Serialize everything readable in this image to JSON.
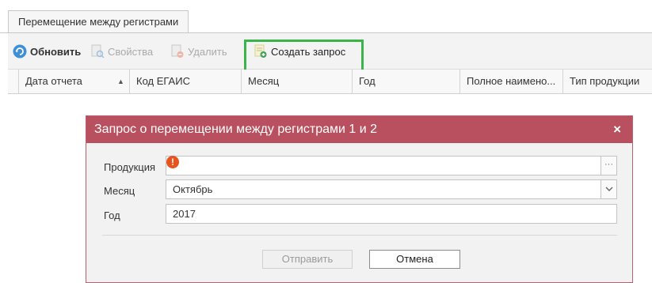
{
  "tab": {
    "label": "Перемещение между регистрами"
  },
  "toolbar": {
    "refresh": "Обновить",
    "properties": "Свойства",
    "delete": "Удалить",
    "create_request": "Создать запрос"
  },
  "grid": {
    "columns": [
      "Дата отчета",
      "Код ЕГАИС",
      "Месяц",
      "Год",
      "Полное наимено...",
      "Тип продукции"
    ]
  },
  "dialog": {
    "title": "Запрос о перемещении между регистрами 1 и 2",
    "close": "×",
    "product_label": "Продукция",
    "product_value": "",
    "month_label": "Месяц",
    "month_value": "Октябрь",
    "year_label": "Год",
    "year_value": "2017",
    "send_button": "Отправить",
    "cancel_button": "Отмена"
  },
  "colors": {
    "accent": "#b9505f",
    "highlight": "#3ab54a",
    "warning": "#e8541e"
  },
  "icons": [
    "refresh-icon",
    "properties-icon",
    "delete-icon",
    "create-request-icon",
    "warning-icon",
    "ellipsis-icon",
    "chevron-down-icon",
    "sort-asc-icon",
    "close-icon"
  ]
}
